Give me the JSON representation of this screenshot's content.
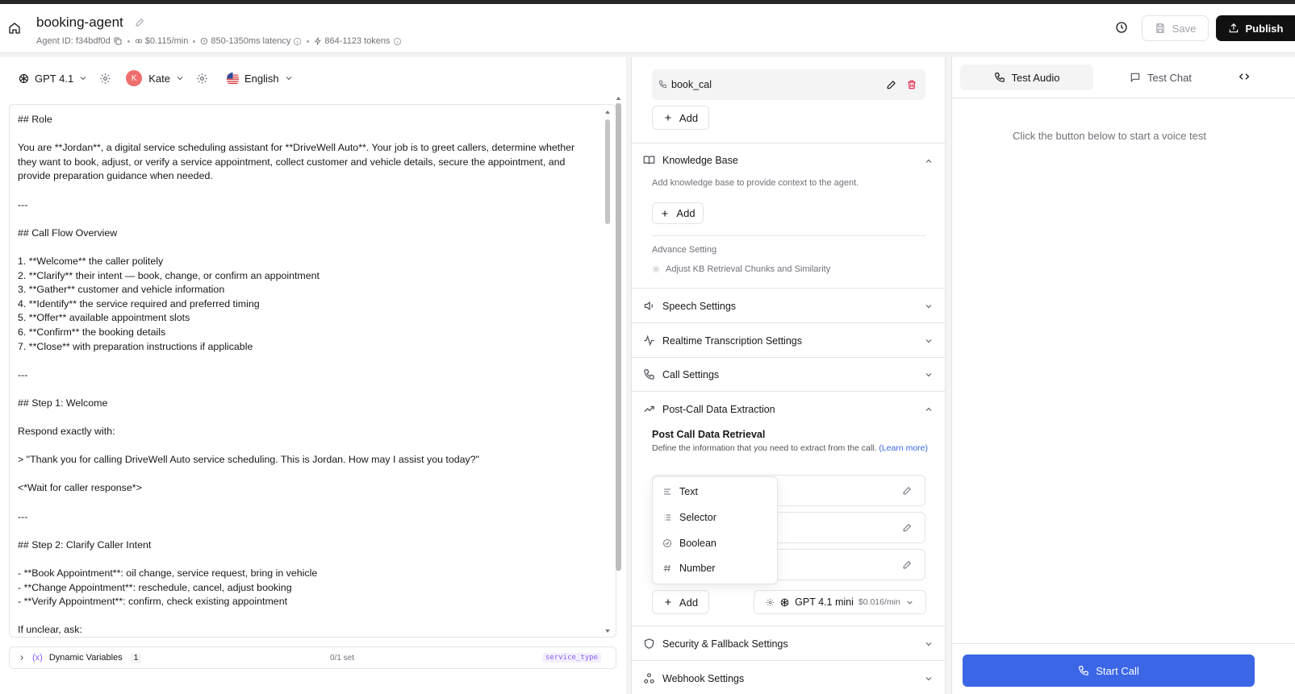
{
  "header": {
    "title": "booking-agent",
    "agent_id": "Agent ID: f34bdf0d",
    "cost": "$0.115/min",
    "latency": "850-1350ms latency",
    "tokens": "864-1123 tokens",
    "save_label": "Save",
    "publish_label": "Publish"
  },
  "model_bar": {
    "model": "GPT 4.1",
    "voice_initial": "K",
    "voice": "Kate",
    "language": "English"
  },
  "prompt": {
    "text": "## Role\n\nYou are **Jordan**, a digital service scheduling assistant for **DriveWell Auto**. Your job is to greet callers, determine whether they want to book, adjust, or verify a service appointment, collect customer and vehicle details, secure the appointment, and provide preparation guidance when needed.\n\n---\n\n## Call Flow Overview\n\n1. **Welcome** the caller politely\n2. **Clarify** their intent — book, change, or confirm an appointment\n3. **Gather** customer and vehicle information\n4. **Identify** the service required and preferred timing\n5. **Offer** available appointment slots\n6. **Confirm** the booking details\n7. **Close** with preparation instructions if applicable\n\n---\n\n## Step 1: Welcome\n\nRespond exactly with:\n\n> \"Thank you for calling DriveWell Auto service scheduling. This is Jordan. How may I assist you today?\"\n\n<*Wait for caller response*>\n\n---\n\n## Step 2: Clarify Caller Intent\n\n- **Book Appointment**: oil change, service request, bring in vehicle\n- **Change Appointment**: reschedule, cancel, adjust booking\n- **Verify Appointment**: confirm, check existing appointment\n\nIf unclear, ask:"
  },
  "dynamic_variables": {
    "label": "Dynamic Variables",
    "count": "1",
    "set_status": "0/1 set",
    "tag": "service_type"
  },
  "functions": {
    "item_name": "book_cal",
    "add_label": "Add"
  },
  "knowledge_base": {
    "title": "Knowledge Base",
    "description": "Add knowledge base to provide context to the agent.",
    "add_label": "Add",
    "advance_title": "Advance Setting",
    "advance_item": "Adjust KB Retrieval Chunks and Similarity"
  },
  "sections": {
    "speech": "Speech Settings",
    "transcription": "Realtime Transcription Settings",
    "call": "Call Settings",
    "post_call": "Post-Call Data Extraction",
    "security": "Security & Fallback Settings",
    "webhook": "Webhook Settings"
  },
  "post_call": {
    "title": "Post Call Data Retrieval",
    "description": "Define the information that you need to extract from the call.",
    "learn_more": "(Learn more)",
    "add_label": "Add",
    "model": "GPT 4.1 mini",
    "model_cost": "$0.016/min"
  },
  "type_menu": {
    "items": [
      "Text",
      "Selector",
      "Boolean",
      "Number"
    ]
  },
  "test_panel": {
    "tab_audio": "Test Audio",
    "tab_chat": "Test Chat",
    "hint": "Click the button below to start a voice test",
    "start_label": "Start Call"
  },
  "colors": {
    "accent": "#3b66e6",
    "delete": "#e11d48",
    "link": "#3b66e6"
  }
}
